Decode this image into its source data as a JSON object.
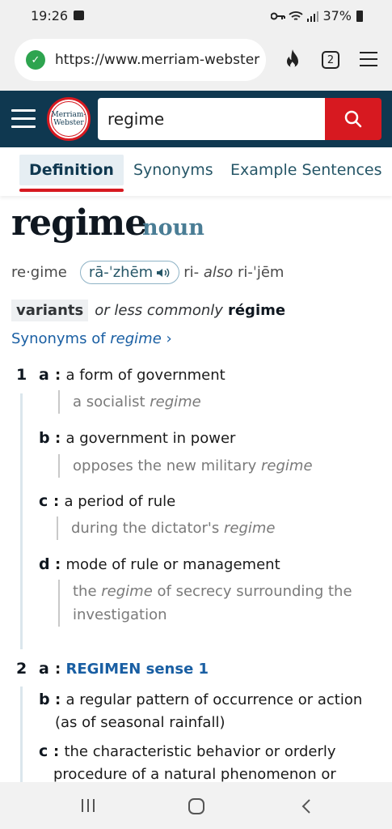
{
  "status": {
    "time": "19:26",
    "battery": "37%",
    "left_icons": [
      "image-icon"
    ],
    "right_icons": [
      "key-icon",
      "wifi-icon",
      "signal-icon",
      "battery-icon"
    ]
  },
  "browser": {
    "url": "https://www.merriam-webster",
    "tab_count": "2"
  },
  "header": {
    "logo_line1": "Merriam-",
    "logo_line2": "Webster",
    "search_value": "regime"
  },
  "tabs": [
    "Definition",
    "Synonyms",
    "Example Sentences"
  ],
  "entry": {
    "headword": "regime",
    "pos": "noun",
    "syllables": "re·gime",
    "pron": "rā-ˈzhēm",
    "alt_pron_prefix": "ri-",
    "alt_pron_also": "also",
    "alt_pron": "ri-ˈjēm",
    "variants_label": "variants",
    "variants_text": "or less commonly",
    "variants_word": "régime",
    "synonyms_link_prefix": "Synonyms of",
    "synonyms_link_word": "regime",
    "synonyms_link_suffix": "›"
  },
  "senses": {
    "s1_num": "1",
    "s1a_letter": "a",
    "s1a_def": "a form of government",
    "s1a_ex_pre": "a socialist",
    "s1a_ex_word": "regime",
    "s1b_letter": "b",
    "s1b_def": "a government in power",
    "s1b_ex_pre": "opposes the new military",
    "s1b_ex_word": "regime",
    "s1c_letter": "c",
    "s1c_def": "a period of rule",
    "s1c_ex_pre": "during the dictator's",
    "s1c_ex_word": "regime",
    "s1d_letter": "d",
    "s1d_def": "mode of rule or management",
    "s1d_ex_pre": "the",
    "s1d_ex_word": "regime",
    "s1d_ex_post": "of secrecy surrounding the",
    "s1d_ex_line2": "investigation",
    "s2_num": "2",
    "s2a_letter": "a",
    "s2a_link": "REGIMEN sense 1",
    "s2b_letter": "b",
    "s2b_def_line1": "a regular pattern of occurrence or action",
    "s2b_def_line2": "(as of seasonal rainfall)",
    "s2c_letter": "c",
    "s2c_def_line1": "the characteristic behavior or orderly",
    "s2c_def_line2": "procedure of a natural phenomenon or"
  }
}
